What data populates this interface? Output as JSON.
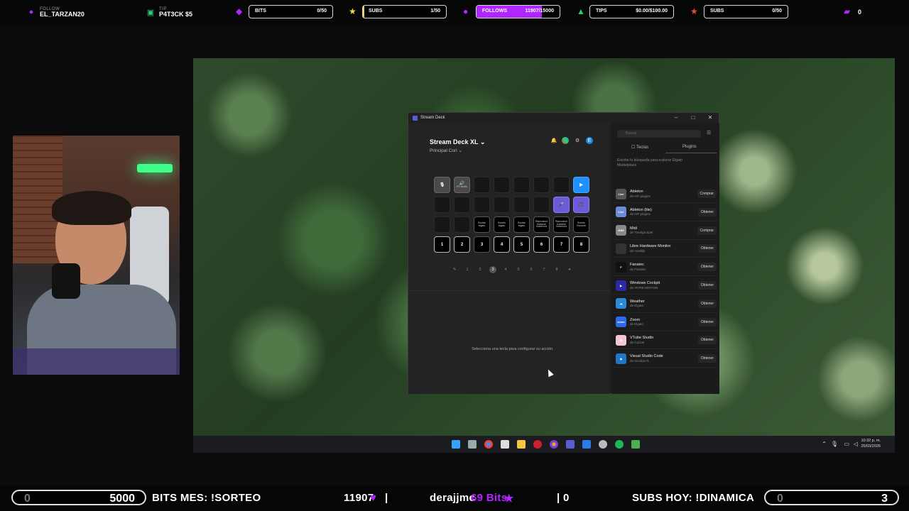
{
  "top_bar": {
    "follow": {
      "small": "FOLLOW",
      "name": "EL_TARZAN20"
    },
    "tip": {
      "small": "TIP",
      "name": "P4T3CK $5"
    },
    "goals": [
      {
        "label": "BITS",
        "value": "0/50",
        "fill": 0.0,
        "color": "#b026ff"
      },
      {
        "label": "SUBS",
        "value": "1/50",
        "fill": 0.02,
        "color": "#f6d743"
      },
      {
        "label": "FOLLOWS",
        "value": "11907/15000",
        "fill": 0.79,
        "color": "#b026ff"
      },
      {
        "label": "TIPS",
        "value": "$0.00/$100.00",
        "fill": 0.0,
        "color": "#2ecc71"
      },
      {
        "label": "SUBS",
        "value": "0/50",
        "fill": 0.0,
        "color": "#e74c3c"
      }
    ],
    "chat_count": "0"
  },
  "stream_deck": {
    "window_title": "Stream Deck",
    "device": "Stream Deck XL",
    "profile": "Principal Cori",
    "keys_row1": [
      "",
      "PC Audio",
      "",
      "",
      "",
      "",
      "",
      ""
    ],
    "row3_labels": [
      "",
      "",
      "Sonido elgato",
      "Sonido elgato",
      "Sonido elgato",
      "Reproducir buclarse Voicemod",
      "Reproducir buclarse Voicemod",
      "Sonido Escuela"
    ],
    "row4_numbers": [
      "1",
      "2",
      "3",
      "4",
      "5",
      "6",
      "7",
      "8"
    ],
    "pages": [
      "1",
      "2",
      "3",
      "4",
      "5",
      "6",
      "7",
      "8"
    ],
    "add_page": "+",
    "hint": "Selecciona una tecla para configurar su acción.",
    "search_placeholder": "Buscar",
    "tabs": {
      "keys": "Teclas",
      "plugins": "Plugins"
    },
    "marketplace_hint": "Escribe tu búsqueda para explorar Elgato Marketplace",
    "plugins": [
      {
        "name": "Ableton",
        "by": "de HiF plugins",
        "action": "Comprar",
        "icon": "Live",
        "color": "#555"
      },
      {
        "name": "Ableton (lite)",
        "by": "de HiF plugins",
        "action": "Obtener",
        "icon": "Live",
        "color": "#6a8bd8"
      },
      {
        "name": "Midi",
        "by": "de Trevliga Spel",
        "action": "Comprar",
        "icon": "MIDI",
        "color": "#888"
      },
      {
        "name": "Libre Hardware Monitor",
        "by": "de moeilijk",
        "action": "Obtener",
        "icon": "",
        "color": "#333"
      },
      {
        "name": "Fanatec",
        "by": "de Fanatec",
        "action": "Obtener",
        "icon": "F",
        "color": "#111"
      },
      {
        "name": "Windows Cockpit",
        "by": "de VIVRE-MOTION",
        "action": "Obtener",
        "icon": "▶",
        "color": "#2a2aa8"
      },
      {
        "name": "Weather",
        "by": "de Elgato",
        "action": "Obtener",
        "icon": "☁",
        "color": "#2b8ad8"
      },
      {
        "name": "Zoom",
        "by": "de Elgato",
        "action": "Obtener",
        "icon": "zoom",
        "color": "#2d6ae8"
      },
      {
        "name": "VTube Studio",
        "by": "de Cazzar",
        "action": "Obtener",
        "icon": "✿",
        "color": "#f3c5d6"
      },
      {
        "name": "Visual Studio Code",
        "by": "de Nicollas R.",
        "action": "Obtener",
        "icon": "◆",
        "color": "#1e76c8"
      }
    ]
  },
  "taskbar": {
    "time": "10:32 p. m.",
    "date": "25/03/2026"
  },
  "bottom_bar": {
    "bits_start": "0",
    "bits_goal": "5000",
    "bits_label": "BITS MES: !SORTEO",
    "follows": "11907",
    "separator1": "|",
    "donor": "derajjmc",
    "donor_bits": "69 Bits",
    "separator2": "| 0",
    "subs_label": "SUBS HOY: !DINAMICA",
    "subs_start": "0",
    "subs_goal": "3"
  }
}
